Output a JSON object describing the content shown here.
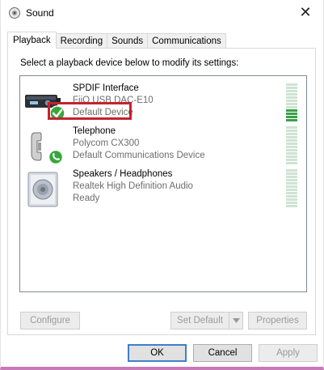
{
  "window": {
    "title": "Sound",
    "close_glyph": "✕"
  },
  "tabs": [
    {
      "label": "Playback",
      "active": true
    },
    {
      "label": "Recording",
      "active": false
    },
    {
      "label": "Sounds",
      "active": false
    },
    {
      "label": "Communications",
      "active": false
    }
  ],
  "instruction": "Select a playback device below to modify its settings:",
  "devices": [
    {
      "name": "SPDIF Interface",
      "line1": "FiiO USB DAC-E10",
      "line2": "Default Device",
      "icon": "spdif-device-icon",
      "badge": "green-check-icon",
      "level": "4 of 12"
    },
    {
      "name": "Telephone",
      "line1": "Polycom CX300",
      "line2": "Default Communications Device",
      "icon": "telephone-icon",
      "badge": "green-phone-icon",
      "level": "0 of 12"
    },
    {
      "name": "Speakers / Headphones",
      "line1": "Realtek High Definition Audio",
      "line2": "Ready",
      "icon": "speaker-icon",
      "level": "0 of 12"
    }
  ],
  "buttons": {
    "configure": "Configure",
    "set_default": "Set Default",
    "properties": "Properties",
    "ok": "OK",
    "cancel": "Cancel",
    "apply": "Apply"
  },
  "colors": {
    "highlight_box": "#c4232e",
    "meter_active": "#3aa04a",
    "meter_inactive": "#cfe3d2",
    "default_button_border": "#3c7fd0"
  }
}
